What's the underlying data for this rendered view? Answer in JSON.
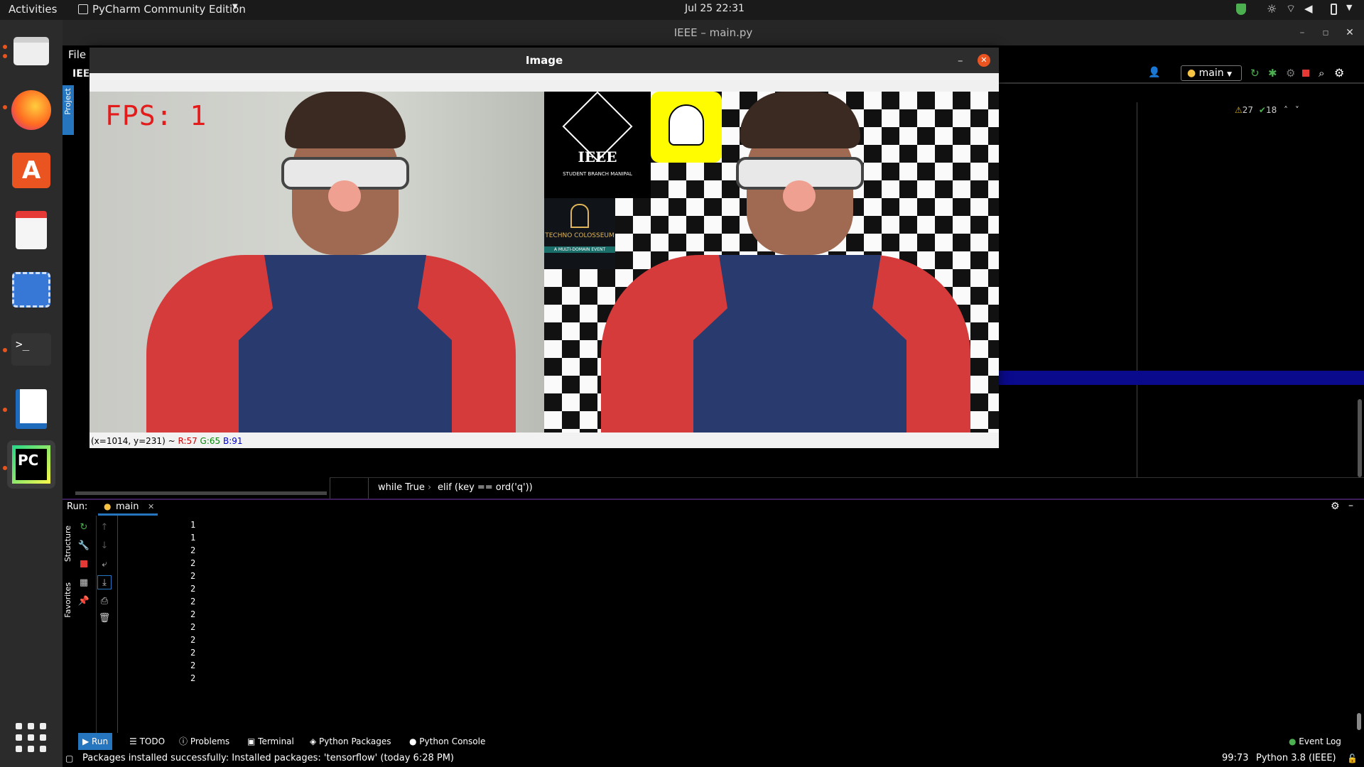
{
  "topbar": {
    "activities": "Activities",
    "app_name": "PyCharm Community Edition",
    "clock": "Jul 25  22:31"
  },
  "window": {
    "title": "IEEE – main.py"
  },
  "menu": {
    "file": "File",
    "project_name": "IEE"
  },
  "sidebar": {
    "project_tab": "Project",
    "structure_tab": "Structure",
    "favorites_tab": "Favorites"
  },
  "toolbar": {
    "run_config": "main"
  },
  "inspections": {
    "warnings": "27",
    "checks": "18"
  },
  "breadcrumbs": {
    "item1": "while True",
    "separator": "›",
    "item2": "elif (key == ord('q'))"
  },
  "run_panel": {
    "label": "Run:",
    "tab": "main",
    "output": [
      "1",
      "1",
      "2",
      "2",
      "2",
      "2",
      "2",
      "2",
      "2",
      "2",
      "2",
      "2",
      "2"
    ]
  },
  "image_window": {
    "title": "Image",
    "fps_text": "FPS: 1",
    "ieee_text": "IEEE",
    "ieee_sub": "STUDENT BRANCH MANIPAL",
    "techno_text": "TECHNO COLOSSEUM",
    "techno_sub": "A MULTI-DOMAIN EVENT",
    "status_coords": "(x=1014, y=231) ~ ",
    "status_r": "R:57",
    "status_g": "G:65",
    "status_b": "B:91"
  },
  "bottom_tabs": {
    "run": "Run",
    "todo": "TODO",
    "problems": "Problems",
    "terminal": "Terminal",
    "packages": "Python Packages",
    "console": "Python Console",
    "event_log": "Event Log"
  },
  "statusbar": {
    "message": "Packages installed successfully: Installed packages: 'tensorflow' (today 6:28 PM)",
    "position": "99:73",
    "interpreter": "Python 3.8 (IEEE)"
  },
  "colors": {
    "accent": "#2675bf",
    "run_stop": "#e53935",
    "run_green": "#4caf50",
    "fps_red": "#e31b1b"
  }
}
